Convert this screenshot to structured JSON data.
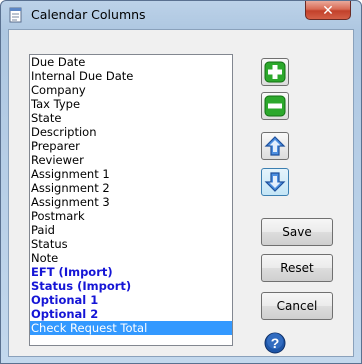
{
  "window": {
    "title": "Calendar Columns",
    "close_label": "✕"
  },
  "columns_list": {
    "items": [
      {
        "label": "Due Date",
        "bold": false,
        "selected": false
      },
      {
        "label": "Internal Due Date",
        "bold": false,
        "selected": false
      },
      {
        "label": "Company",
        "bold": false,
        "selected": false
      },
      {
        "label": "Tax Type",
        "bold": false,
        "selected": false
      },
      {
        "label": "State",
        "bold": false,
        "selected": false
      },
      {
        "label": "Description",
        "bold": false,
        "selected": false
      },
      {
        "label": "Preparer",
        "bold": false,
        "selected": false
      },
      {
        "label": "Reviewer",
        "bold": false,
        "selected": false
      },
      {
        "label": "Assignment 1",
        "bold": false,
        "selected": false
      },
      {
        "label": "Assignment 2",
        "bold": false,
        "selected": false
      },
      {
        "label": "Assignment 3",
        "bold": false,
        "selected": false
      },
      {
        "label": "Postmark",
        "bold": false,
        "selected": false
      },
      {
        "label": "Paid",
        "bold": false,
        "selected": false
      },
      {
        "label": "Status",
        "bold": false,
        "selected": false
      },
      {
        "label": "Note",
        "bold": false,
        "selected": false
      },
      {
        "label": "EFT (Import)",
        "bold": true,
        "selected": false
      },
      {
        "label": "Status (Import)",
        "bold": true,
        "selected": false
      },
      {
        "label": "Optional 1",
        "bold": true,
        "selected": false
      },
      {
        "label": "Optional 2",
        "bold": true,
        "selected": false
      },
      {
        "label": "Check Request Total",
        "bold": false,
        "selected": true
      }
    ]
  },
  "buttons": {
    "add_icon": "plus-icon",
    "remove_icon": "minus-icon",
    "up_icon": "arrow-up-icon",
    "down_icon": "arrow-down-icon",
    "save": "Save",
    "reset": "Reset",
    "cancel": "Cancel",
    "help_icon": "help-icon"
  },
  "colors": {
    "custom_column_text": "#1515d6",
    "selection": "#3399ff",
    "add_green": "#1f9d1f",
    "arrow_blue": "#2f6fd0",
    "help_blue": "#1c4f9c"
  }
}
